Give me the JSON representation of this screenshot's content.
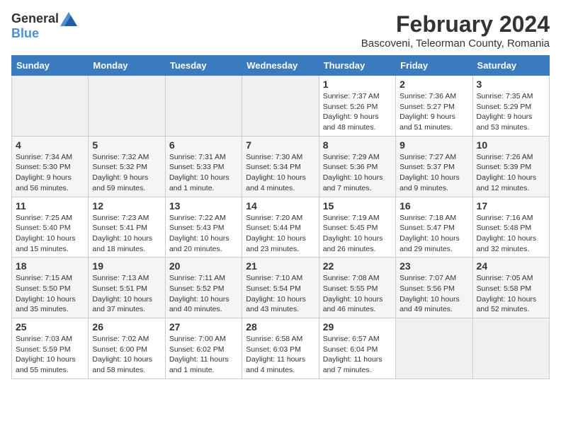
{
  "header": {
    "logo_general": "General",
    "logo_blue": "Blue",
    "title": "February 2024",
    "subtitle": "Bascoveni, Teleorman County, Romania"
  },
  "days_of_week": [
    "Sunday",
    "Monday",
    "Tuesday",
    "Wednesday",
    "Thursday",
    "Friday",
    "Saturday"
  ],
  "weeks": [
    {
      "days": [
        {
          "num": "",
          "info": ""
        },
        {
          "num": "",
          "info": ""
        },
        {
          "num": "",
          "info": ""
        },
        {
          "num": "",
          "info": ""
        },
        {
          "num": "1",
          "info": "Sunrise: 7:37 AM\nSunset: 5:26 PM\nDaylight: 9 hours\nand 48 minutes."
        },
        {
          "num": "2",
          "info": "Sunrise: 7:36 AM\nSunset: 5:27 PM\nDaylight: 9 hours\nand 51 minutes."
        },
        {
          "num": "3",
          "info": "Sunrise: 7:35 AM\nSunset: 5:29 PM\nDaylight: 9 hours\nand 53 minutes."
        }
      ]
    },
    {
      "days": [
        {
          "num": "4",
          "info": "Sunrise: 7:34 AM\nSunset: 5:30 PM\nDaylight: 9 hours\nand 56 minutes."
        },
        {
          "num": "5",
          "info": "Sunrise: 7:32 AM\nSunset: 5:32 PM\nDaylight: 9 hours\nand 59 minutes."
        },
        {
          "num": "6",
          "info": "Sunrise: 7:31 AM\nSunset: 5:33 PM\nDaylight: 10 hours\nand 1 minute."
        },
        {
          "num": "7",
          "info": "Sunrise: 7:30 AM\nSunset: 5:34 PM\nDaylight: 10 hours\nand 4 minutes."
        },
        {
          "num": "8",
          "info": "Sunrise: 7:29 AM\nSunset: 5:36 PM\nDaylight: 10 hours\nand 7 minutes."
        },
        {
          "num": "9",
          "info": "Sunrise: 7:27 AM\nSunset: 5:37 PM\nDaylight: 10 hours\nand 9 minutes."
        },
        {
          "num": "10",
          "info": "Sunrise: 7:26 AM\nSunset: 5:39 PM\nDaylight: 10 hours\nand 12 minutes."
        }
      ]
    },
    {
      "days": [
        {
          "num": "11",
          "info": "Sunrise: 7:25 AM\nSunset: 5:40 PM\nDaylight: 10 hours\nand 15 minutes."
        },
        {
          "num": "12",
          "info": "Sunrise: 7:23 AM\nSunset: 5:41 PM\nDaylight: 10 hours\nand 18 minutes."
        },
        {
          "num": "13",
          "info": "Sunrise: 7:22 AM\nSunset: 5:43 PM\nDaylight: 10 hours\nand 20 minutes."
        },
        {
          "num": "14",
          "info": "Sunrise: 7:20 AM\nSunset: 5:44 PM\nDaylight: 10 hours\nand 23 minutes."
        },
        {
          "num": "15",
          "info": "Sunrise: 7:19 AM\nSunset: 5:45 PM\nDaylight: 10 hours\nand 26 minutes."
        },
        {
          "num": "16",
          "info": "Sunrise: 7:18 AM\nSunset: 5:47 PM\nDaylight: 10 hours\nand 29 minutes."
        },
        {
          "num": "17",
          "info": "Sunrise: 7:16 AM\nSunset: 5:48 PM\nDaylight: 10 hours\nand 32 minutes."
        }
      ]
    },
    {
      "days": [
        {
          "num": "18",
          "info": "Sunrise: 7:15 AM\nSunset: 5:50 PM\nDaylight: 10 hours\nand 35 minutes."
        },
        {
          "num": "19",
          "info": "Sunrise: 7:13 AM\nSunset: 5:51 PM\nDaylight: 10 hours\nand 37 minutes."
        },
        {
          "num": "20",
          "info": "Sunrise: 7:11 AM\nSunset: 5:52 PM\nDaylight: 10 hours\nand 40 minutes."
        },
        {
          "num": "21",
          "info": "Sunrise: 7:10 AM\nSunset: 5:54 PM\nDaylight: 10 hours\nand 43 minutes."
        },
        {
          "num": "22",
          "info": "Sunrise: 7:08 AM\nSunset: 5:55 PM\nDaylight: 10 hours\nand 46 minutes."
        },
        {
          "num": "23",
          "info": "Sunrise: 7:07 AM\nSunset: 5:56 PM\nDaylight: 10 hours\nand 49 minutes."
        },
        {
          "num": "24",
          "info": "Sunrise: 7:05 AM\nSunset: 5:58 PM\nDaylight: 10 hours\nand 52 minutes."
        }
      ]
    },
    {
      "days": [
        {
          "num": "25",
          "info": "Sunrise: 7:03 AM\nSunset: 5:59 PM\nDaylight: 10 hours\nand 55 minutes."
        },
        {
          "num": "26",
          "info": "Sunrise: 7:02 AM\nSunset: 6:00 PM\nDaylight: 10 hours\nand 58 minutes."
        },
        {
          "num": "27",
          "info": "Sunrise: 7:00 AM\nSunset: 6:02 PM\nDaylight: 11 hours\nand 1 minute."
        },
        {
          "num": "28",
          "info": "Sunrise: 6:58 AM\nSunset: 6:03 PM\nDaylight: 11 hours\nand 4 minutes."
        },
        {
          "num": "29",
          "info": "Sunrise: 6:57 AM\nSunset: 6:04 PM\nDaylight: 11 hours\nand 7 minutes."
        },
        {
          "num": "",
          "info": ""
        },
        {
          "num": "",
          "info": ""
        }
      ]
    }
  ]
}
